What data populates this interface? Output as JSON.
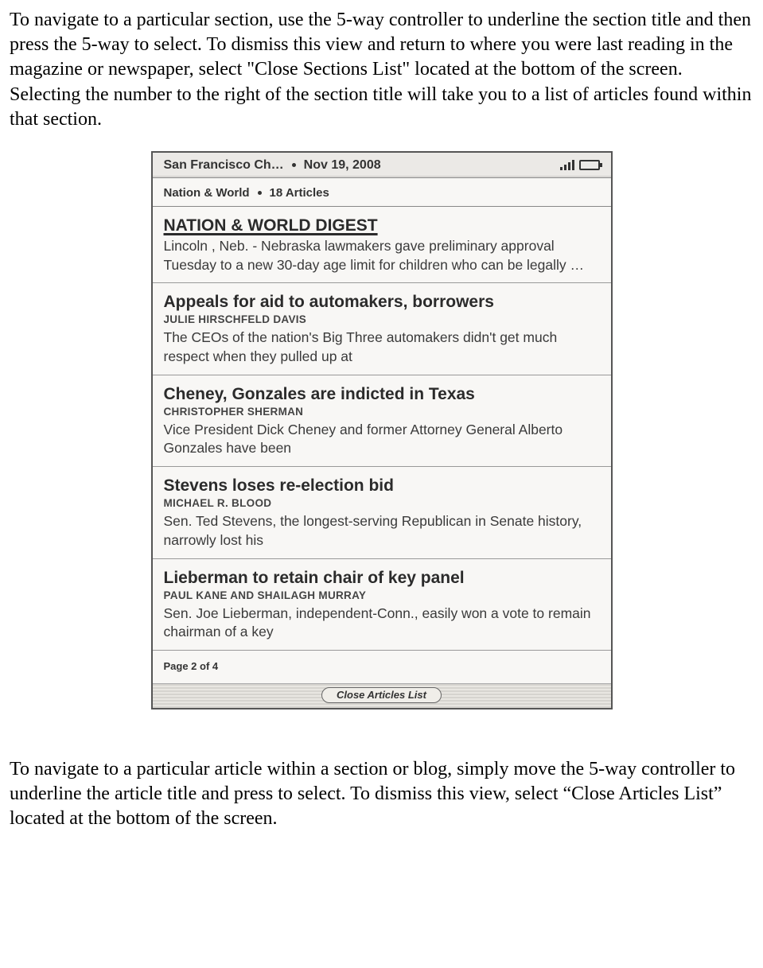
{
  "doc": {
    "paragraph_top": "To navigate to a particular section, use the 5-way controller to underline the section title and then press the 5-way to select. To dismiss this view and return to where you were last reading in the magazine or newspaper, select \"Close Sections List\" located at the bottom of the screen.  Selecting the number to the right of the section title will take you to a list of articles found within that section.",
    "paragraph_bottom": "To navigate to a particular article within a section or blog, simply move the 5-way controller to underline the article title and press to select.  To dismiss this view, select “Close Articles List” located at the bottom of the screen."
  },
  "device": {
    "header": {
      "newspaper": "San Francisco Ch…",
      "date": "Nov 19, 2008"
    },
    "section": {
      "name": "Nation & World",
      "count_label": "18 Articles"
    },
    "articles": [
      {
        "title": "NATION & WORLD DIGEST",
        "byline": "",
        "excerpt": "Lincoln , Neb. - Nebraska lawmakers gave preliminary approval Tuesday to a new 30-day age limit for children who can be legally …",
        "selected": true
      },
      {
        "title": "Appeals for aid to automakers, borrowers",
        "byline": "JULIE HIRSCHFELD DAVIS",
        "excerpt": "The CEOs of the nation's Big Three automakers didn't get much respect when they pulled up at",
        "selected": false
      },
      {
        "title": "Cheney, Gonzales are indicted in Texas",
        "byline": "CHRISTOPHER SHERMAN",
        "excerpt": "Vice President Dick Cheney and former Attorney General Alberto Gonzales have been",
        "selected": false
      },
      {
        "title": "Stevens loses re-election bid",
        "byline": "MICHAEL R. BLOOD",
        "excerpt": "Sen. Ted Stevens, the longest-serving Republican in Senate history, narrowly lost his",
        "selected": false
      },
      {
        "title": "Lieberman to retain chair of key panel",
        "byline": "PAUL KANE AND SHAILAGH MURRAY",
        "excerpt": "Sen. Joe Lieberman, independent-Conn., easily won a vote to remain chairman of a key",
        "selected": false
      }
    ],
    "page_indicator": "Page 2 of 4",
    "close_button_label": "Close Articles List"
  }
}
